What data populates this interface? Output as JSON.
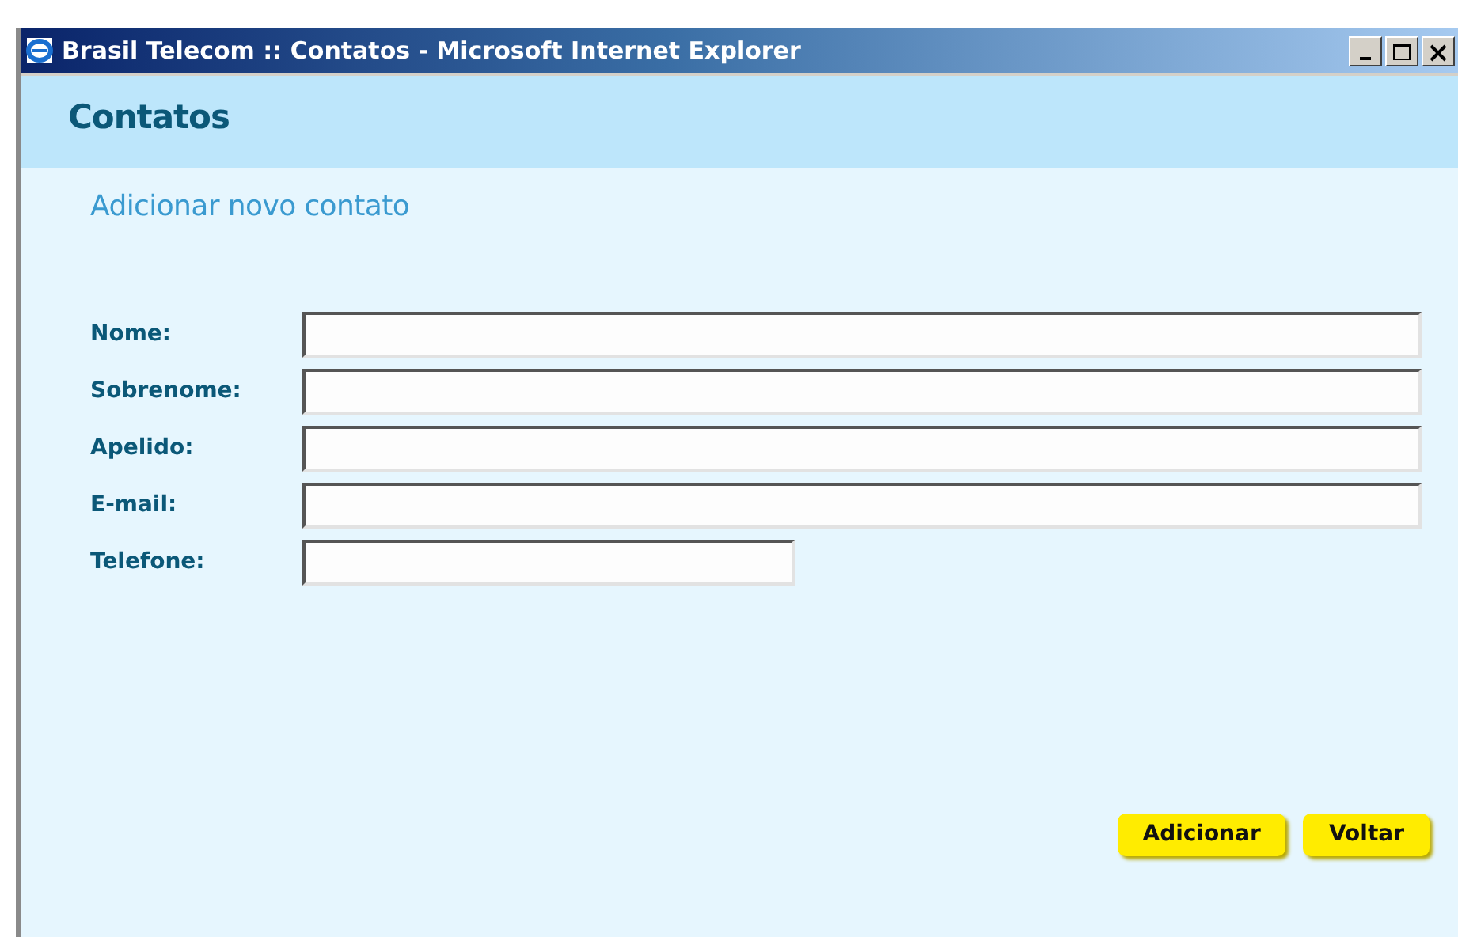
{
  "window": {
    "title": "Brasil Telecom :: Contatos - Microsoft Internet Explorer"
  },
  "header": {
    "title": "Contatos"
  },
  "form": {
    "title": "Adicionar novo contato",
    "fields": [
      {
        "label": "Nome:",
        "kind": "long"
      },
      {
        "label": "Sobrenome:",
        "kind": "long"
      },
      {
        "label": "Apelido:",
        "kind": "long"
      },
      {
        "label": "E-mail:",
        "kind": "long"
      },
      {
        "label": "Telefone:",
        "kind": "short"
      }
    ]
  },
  "buttons": [
    "Adicionar",
    "Voltar"
  ]
}
